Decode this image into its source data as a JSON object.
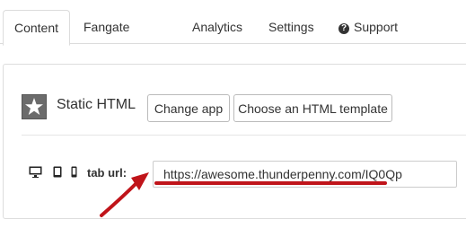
{
  "tabs": {
    "content": "Content",
    "fangate": "Fangate",
    "analytics": "Analytics",
    "settings": "Settings",
    "support": "Support"
  },
  "app": {
    "title": "Static HTML",
    "icon": "star-icon",
    "change_app_label": "Change app",
    "template_label": "Choose an HTML template"
  },
  "tab_url": {
    "label": "tab url:",
    "value": "https://awesome.thunderpenny.com/IQ0Qp",
    "devices": [
      "desktop-icon",
      "tablet-icon",
      "phone-icon"
    ]
  },
  "colors": {
    "highlight": "#c0141a",
    "icon_bg": "#6b6b6b"
  }
}
